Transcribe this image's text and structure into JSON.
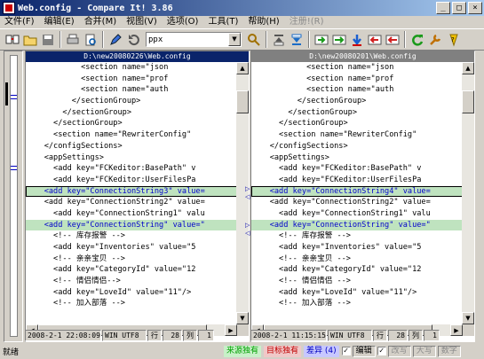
{
  "window": {
    "title": "Web.config - Compare It! 3.86"
  },
  "menu": [
    {
      "label": "文件(F)",
      "disabled": false
    },
    {
      "label": "编辑(E)",
      "disabled": false
    },
    {
      "label": "合并(M)",
      "disabled": false
    },
    {
      "label": "视图(V)",
      "disabled": false
    },
    {
      "label": "选项(O)",
      "disabled": false
    },
    {
      "label": "工具(T)",
      "disabled": false
    },
    {
      "label": "帮助(H)",
      "disabled": false
    },
    {
      "label": "注册!(R)",
      "disabled": true
    }
  ],
  "toolbar": {
    "filter_value": "ppx"
  },
  "left": {
    "path": "D:\\new20080226\\Web.config",
    "lines": [
      {
        "text": "            <section name=\"json",
        "diff": false
      },
      {
        "text": "            <section name=\"prof",
        "diff": false
      },
      {
        "text": "            <section name=\"auth",
        "diff": false
      },
      {
        "text": "          </sectionGroup>",
        "diff": false
      },
      {
        "text": "        </sectionGroup>",
        "diff": false
      },
      {
        "text": "      </sectionGroup>",
        "diff": false
      },
      {
        "text": "      <section name=\"RewriterConfig\" ",
        "diff": false
      },
      {
        "text": "    </configSections>",
        "diff": false
      },
      {
        "text": "    <appSettings>",
        "diff": false
      },
      {
        "text": "      <add key=\"FCKeditor:BasePath\" v",
        "diff": false
      },
      {
        "text": "      <add key=\"FCKeditor:UserFilesPa",
        "diff": false
      },
      {
        "text": "    <add key=\"ConnectionString3\" value=",
        "diff": true
      },
      {
        "text": "    <add key=\"ConnectionString2\" value=",
        "diff": false
      },
      {
        "text": "      <add key=\"ConnectionString1\" valu",
        "diff": false
      },
      {
        "text": "    <add key=\"ConnectionString\" value=\"",
        "diff": true
      },
      {
        "text": "      <!-- 库存报警 -->",
        "diff": false
      },
      {
        "text": "      <add key=\"Inventories\" value=\"5",
        "diff": false
      },
      {
        "text": "      <!-- 亲亲宝贝 -->",
        "diff": false
      },
      {
        "text": "      <add key=\"CategoryId\" value=\"12",
        "diff": false
      },
      {
        "text": "      <!-- 情侣情侣-->",
        "diff": false
      },
      {
        "text": "      <add key=\"LoveId\" value=\"11\"/>",
        "diff": false
      },
      {
        "text": "      <!-- 加入部落 -->",
        "diff": false
      }
    ],
    "status": {
      "datetime": "2008-2-1  22:08:09",
      "encoding": "WIN UTF8",
      "row_label": "行",
      "row": "28",
      "col_label": "列",
      "col": "1"
    }
  },
  "right": {
    "path": "D:\\new20080201\\Web.config",
    "lines": [
      {
        "text": "            <section name=\"json",
        "diff": false
      },
      {
        "text": "            <section name=\"prof",
        "diff": false
      },
      {
        "text": "            <section name=\"auth",
        "diff": false
      },
      {
        "text": "          </sectionGroup>",
        "diff": false
      },
      {
        "text": "        </sectionGroup>",
        "diff": false
      },
      {
        "text": "      </sectionGroup>",
        "diff": false
      },
      {
        "text": "      <section name=\"RewriterConfig\" ",
        "diff": false
      },
      {
        "text": "    </configSections>",
        "diff": false
      },
      {
        "text": "    <appSettings>",
        "diff": false
      },
      {
        "text": "      <add key=\"FCKeditor:BasePath\" v",
        "diff": false
      },
      {
        "text": "      <add key=\"FCKeditor:UserFilesPa",
        "diff": false
      },
      {
        "text": "    <add key=\"ConnectionString4\" value=",
        "diff": true
      },
      {
        "text": "    <add key=\"ConnectionString2\" value=",
        "diff": false
      },
      {
        "text": "      <add key=\"ConnectionString1\" valu",
        "diff": false
      },
      {
        "text": "    <add key=\"ConnectionString\" value=\"",
        "diff": true
      },
      {
        "text": "      <!-- 库存报警 -->",
        "diff": false
      },
      {
        "text": "      <add key=\"Inventories\" value=\"5",
        "diff": false
      },
      {
        "text": "      <!-- 亲亲宝贝 -->",
        "diff": false
      },
      {
        "text": "      <add key=\"CategoryId\" value=\"12",
        "diff": false
      },
      {
        "text": "      <!-- 情侣情侣 -->",
        "diff": false
      },
      {
        "text": "      <add key=\"LoveId\" value=\"11\"/>",
        "diff": false
      },
      {
        "text": "      <!-- 加入部落 -->",
        "diff": false
      }
    ],
    "status": {
      "datetime": "2008-2-1  11:15:15",
      "encoding": "WIN UTF8",
      "row_label": "行",
      "row": "28",
      "col_label": "列",
      "col": "1"
    }
  },
  "statusbar": {
    "ready": "就绪",
    "source_only": "来源独有",
    "target_only": "目标独有",
    "diff_label": "差异 (4)",
    "encoding_label": "编辑",
    "modified": "改写",
    "caps": "大写",
    "num": "数字"
  },
  "colors": {
    "diff_bg": "#bfe3bf",
    "diff_text": "#0000cc",
    "active_header": "#0a246a"
  }
}
